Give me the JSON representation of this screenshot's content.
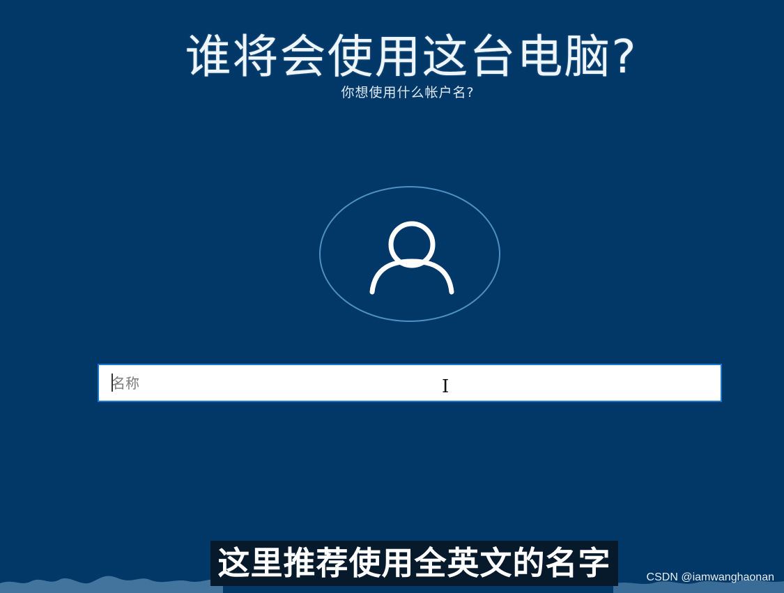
{
  "page": {
    "title": "谁将会使用这台电脑?",
    "subtitle": "你想使用什么帐户名?"
  },
  "avatar": {
    "icon": "user-icon"
  },
  "input": {
    "placeholder": "名称",
    "value": ""
  },
  "overlay": {
    "caption": "这里推荐使用全英文的名字",
    "watermark": "CSDN @iamwanghaonan"
  },
  "colors": {
    "background": "#023868",
    "input_border": "#1778d0",
    "avatar_ring": "#4d90c2"
  }
}
